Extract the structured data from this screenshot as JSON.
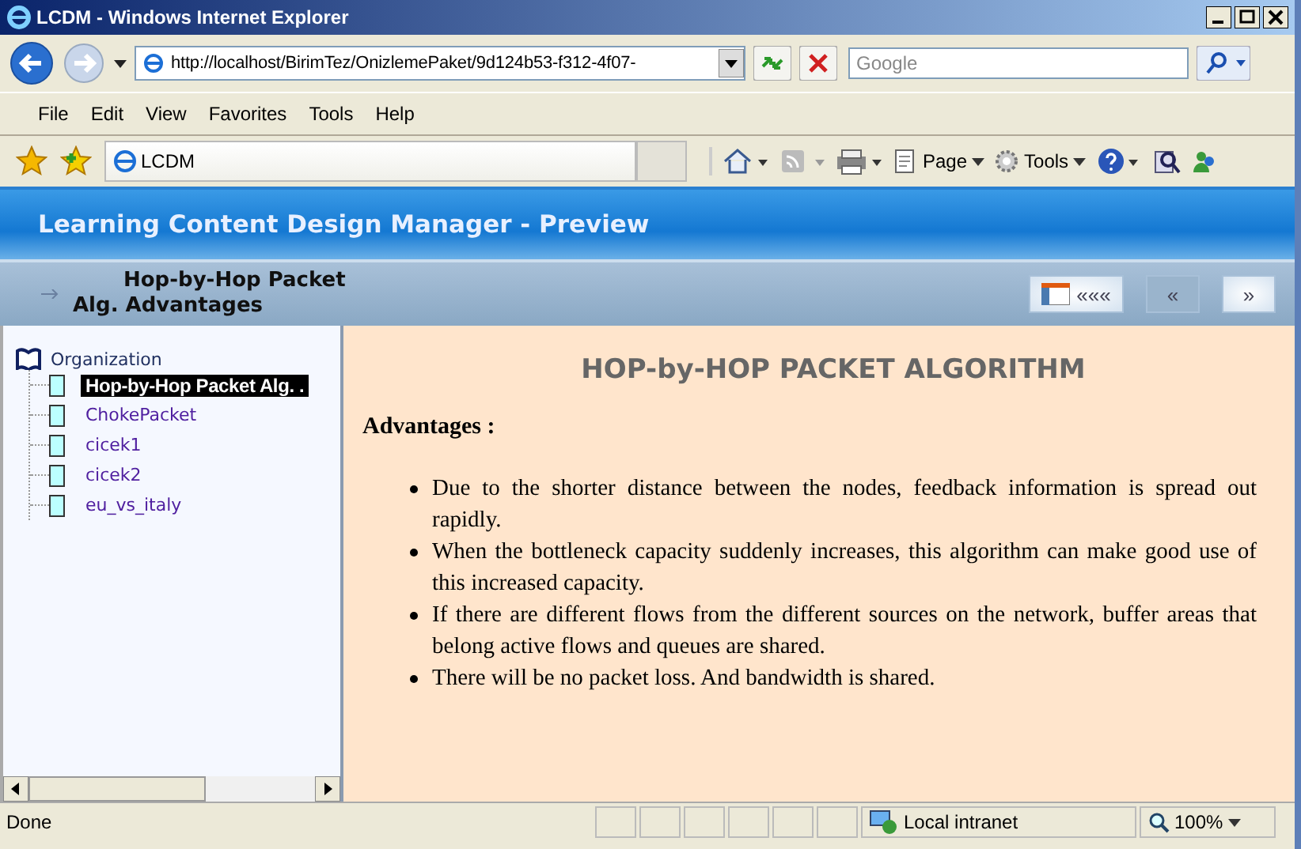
{
  "window": {
    "title": "LCDM - Windows Internet Explorer"
  },
  "address_bar": {
    "value": "http://localhost/BirimTez/OnizlemePaket/9d124b53-f312-4f07-"
  },
  "search": {
    "placeholder": "Google"
  },
  "menu": [
    "File",
    "Edit",
    "View",
    "Favorites",
    "Tools",
    "Help"
  ],
  "tab": {
    "label": "LCDM"
  },
  "command_bar": [
    {
      "kind": "home"
    },
    {
      "kind": "feeds"
    },
    {
      "kind": "print"
    },
    {
      "kind": "page",
      "label": "Page"
    },
    {
      "kind": "tools",
      "label": "Tools"
    },
    {
      "kind": "help"
    }
  ],
  "app": {
    "title": "Learning Content Design Manager - Preview",
    "breadcrumb": "Hop-by-Hop Packet Alg. Advantages",
    "nav": [
      {
        "kind": "layout",
        "label": "«««"
      },
      {
        "kind": "prev",
        "label": "«"
      },
      {
        "kind": "next",
        "label": "»"
      }
    ]
  },
  "tree": {
    "label": "Organization",
    "expanded": true,
    "children": [
      {
        "label": "Hop-by-Hop Packet Alg. .",
        "selected": true
      },
      {
        "label": "ChokePacket",
        "selected": false
      },
      {
        "label": "cicek1",
        "selected": false
      },
      {
        "label": "cicek2",
        "selected": false
      },
      {
        "label": "eu_vs_italy",
        "selected": false
      }
    ]
  },
  "content": {
    "heading": "HOP-by-HOP PACKET ALGORITHM",
    "subheading": "Advantages :",
    "bullets": [
      "Due to the shorter distance between the nodes, feedback information is spread out rapidly.",
      "When the bottleneck capacity suddenly increases, this algorithm can make good use of this increased capacity.",
      "If there are different flows from the different sources on the network, buffer areas that belong active flows and queues are shared.",
      "There will be no packet loss. And bandwidth is shared."
    ]
  },
  "status_bar": {
    "text": "Done",
    "zone": "Local intranet",
    "zoom": "100%"
  }
}
